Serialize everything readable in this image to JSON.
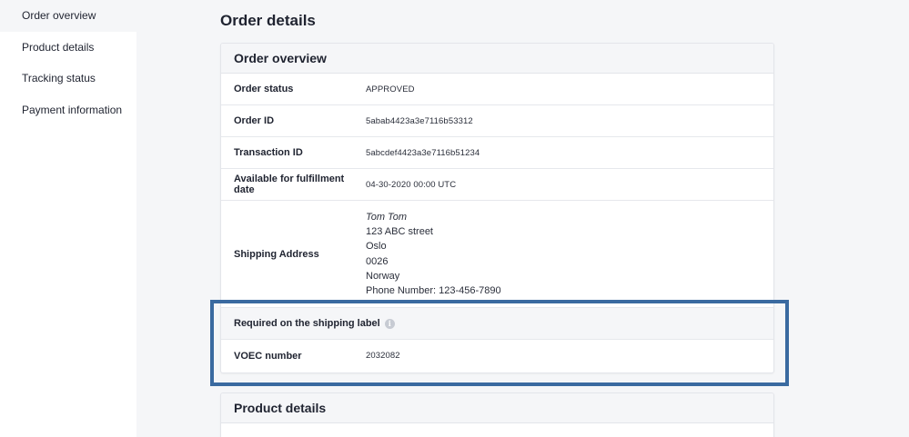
{
  "sidebar": {
    "items": [
      {
        "label": "Order overview"
      },
      {
        "label": "Product details"
      },
      {
        "label": "Tracking status"
      },
      {
        "label": "Payment information"
      }
    ]
  },
  "main": {
    "title": "Order details",
    "overview": {
      "header": "Order overview",
      "rows": {
        "status": {
          "label": "Order status",
          "value": "APPROVED"
        },
        "order_id": {
          "label": "Order ID",
          "value": "5abab4423a3e7116b53312"
        },
        "transaction_id": {
          "label": "Transaction ID",
          "value": "5abcdef4423a3e7116b51234"
        },
        "fulfillment": {
          "label": "Available for fulfillment date",
          "value": "04-30-2020 00:00 UTC"
        },
        "shipping": {
          "label": "Shipping Address",
          "name": "Tom Tom",
          "street": "123 ABC street",
          "city": "Oslo",
          "postal": "0026",
          "country": "Norway",
          "phone": "Phone Number: 123-456-7890"
        }
      },
      "shipping_label": {
        "header": "Required on the shipping label",
        "info_glyph": "i",
        "voec": {
          "label": "VOEC number",
          "value": "2032082"
        }
      }
    },
    "product": {
      "header": "Product details"
    }
  },
  "colors": {
    "highlight": "#3a6aa0",
    "background": "#f5f6f8"
  },
  "icons": {
    "info": "info-icon"
  }
}
